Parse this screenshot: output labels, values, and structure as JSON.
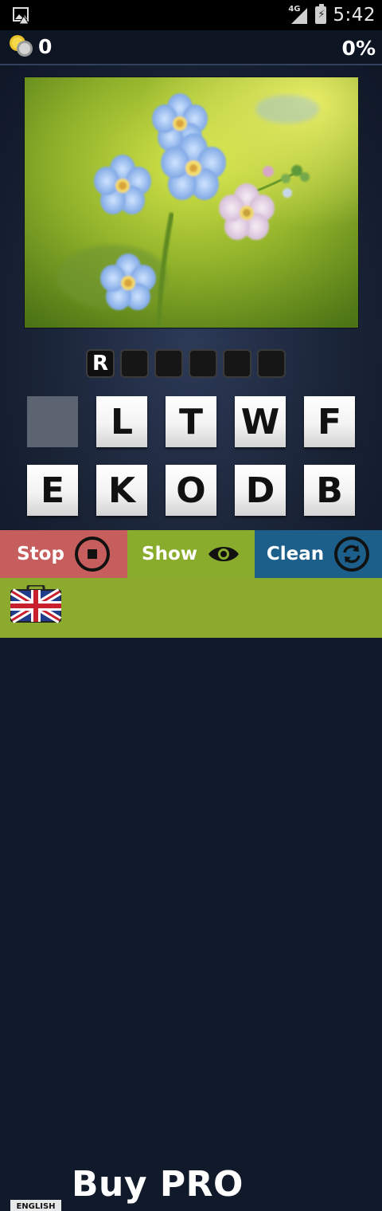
{
  "status_bar": {
    "time": "5:42",
    "network": "4G",
    "icons": [
      "image-notification-icon",
      "signal-icon",
      "battery-charging-icon"
    ]
  },
  "top_bar": {
    "coins": "0",
    "progress": "0%",
    "icon": "coins-icon"
  },
  "puzzle": {
    "image_icon": "flower-photo",
    "answer_slots": [
      "R",
      "",
      "",
      "",
      "",
      ""
    ],
    "letters": [
      "",
      "L",
      "T",
      "W",
      "F",
      "E",
      "K",
      "O",
      "D",
      "B"
    ]
  },
  "actions": {
    "stop_label": "Stop",
    "show_label": "Show",
    "clean_label": "Clean"
  },
  "promo": {
    "buy_label": "Buy PRO",
    "language_label": "ENGLISH"
  },
  "colors": {
    "stop": "#c75e5e",
    "show": "#8aac2d",
    "clean": "#1b5f8a",
    "promo": "#8caa2e"
  }
}
